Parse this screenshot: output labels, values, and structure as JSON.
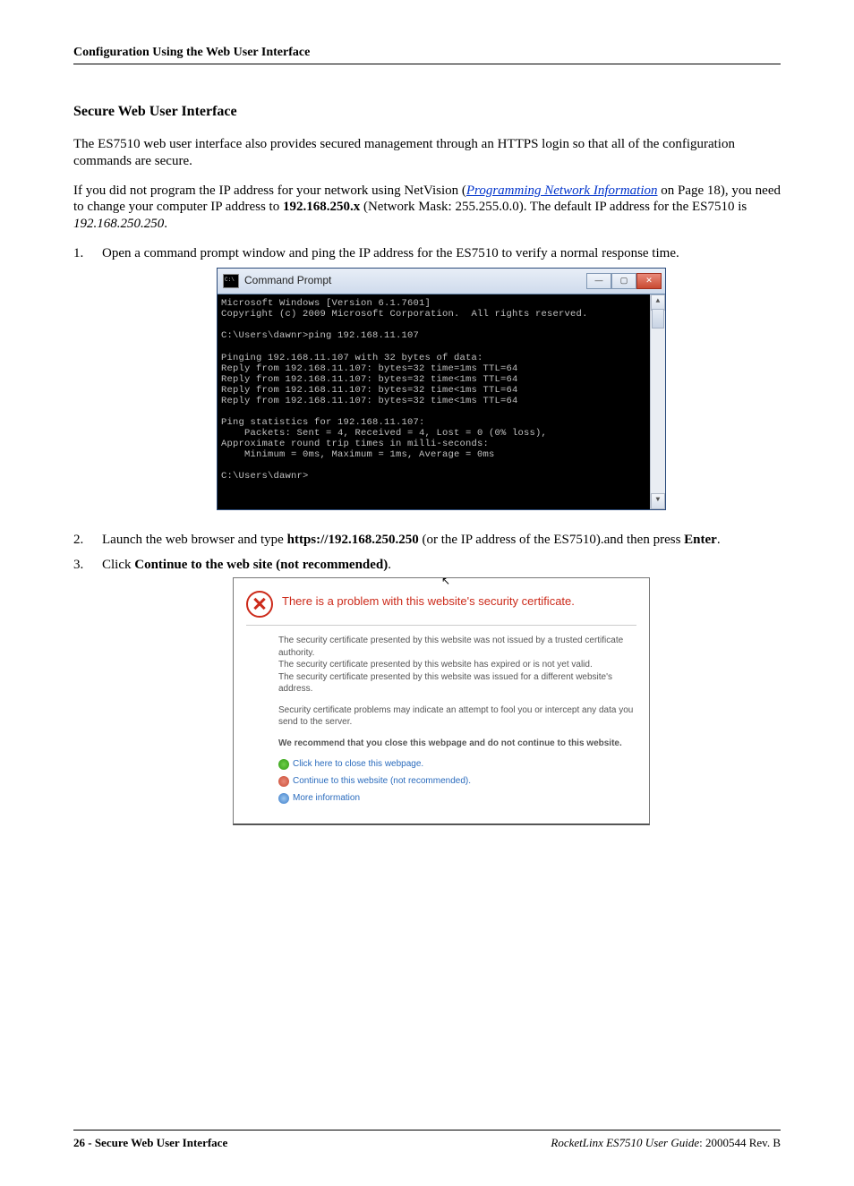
{
  "header": {
    "title": "Configuration Using the Web User Interface"
  },
  "section_title": "Secure Web User Interface",
  "para1": "The ES7510 web user interface also provides secured management through an HTTPS login so that all of the configuration commands are secure.",
  "para2": {
    "pre": "If you did not program the IP address for your network using NetVision (",
    "link": "Programming Network Information",
    "post_link": " on Page 18), you need to change your computer IP address to ",
    "bold_ip": "192.168.250.x",
    "post_ip": " (Network Mask: 255.255.0.0). The default IP address for the ES7510 is ",
    "italic_ip": "192.168.250.250",
    "end": "."
  },
  "step1": "Open a command prompt window and ping the IP address for the ES7510 to verify a normal response time.",
  "step2": {
    "pre": "Launch the web browser and type ",
    "bold": "https://192.168.250.250",
    "mid": " (or the IP address of the ES7510).and then press ",
    "bold2": "Enter",
    "end": "."
  },
  "step3": {
    "pre": "Click ",
    "bold": "Continue to the web site (not recommended)",
    "end": "."
  },
  "cmd": {
    "title": "Command Prompt",
    "body": "Microsoft Windows [Version 6.1.7601]\nCopyright (c) 2009 Microsoft Corporation.  All rights reserved.\n\nC:\\Users\\dawnr>ping 192.168.11.107\n\nPinging 192.168.11.107 with 32 bytes of data:\nReply from 192.168.11.107: bytes=32 time=1ms TTL=64\nReply from 192.168.11.107: bytes=32 time<1ms TTL=64\nReply from 192.168.11.107: bytes=32 time<1ms TTL=64\nReply from 192.168.11.107: bytes=32 time<1ms TTL=64\n\nPing statistics for 192.168.11.107:\n    Packets: Sent = 4, Received = 4, Lost = 0 (0% loss),\nApproximate round trip times in milli-seconds:\n    Minimum = 0ms, Maximum = 1ms, Average = 0ms\n\nC:\\Users\\dawnr>"
  },
  "cert": {
    "heading": "There is a problem with this website's security certificate.",
    "p1a": "The security certificate presented by this website was not issued by a trusted certificate authority.",
    "p1b": "The security certificate presented by this website has expired or is not yet valid.",
    "p1c": "The security certificate presented by this website was issued for a different website's address.",
    "p2": "Security certificate problems may indicate an attempt to fool you or intercept any data you send to the server.",
    "p3": "We recommend that you close this webpage and do not continue to this website.",
    "link_close": "Click here to close this webpage.",
    "link_continue": "Continue to this website (not recommended).",
    "link_more": "More information"
  },
  "footer": {
    "left": "26 - Secure Web User Interface",
    "right_italic": "RocketLinx ES7510  User Guide",
    "right_plain": ": 2000544 Rev. B"
  }
}
